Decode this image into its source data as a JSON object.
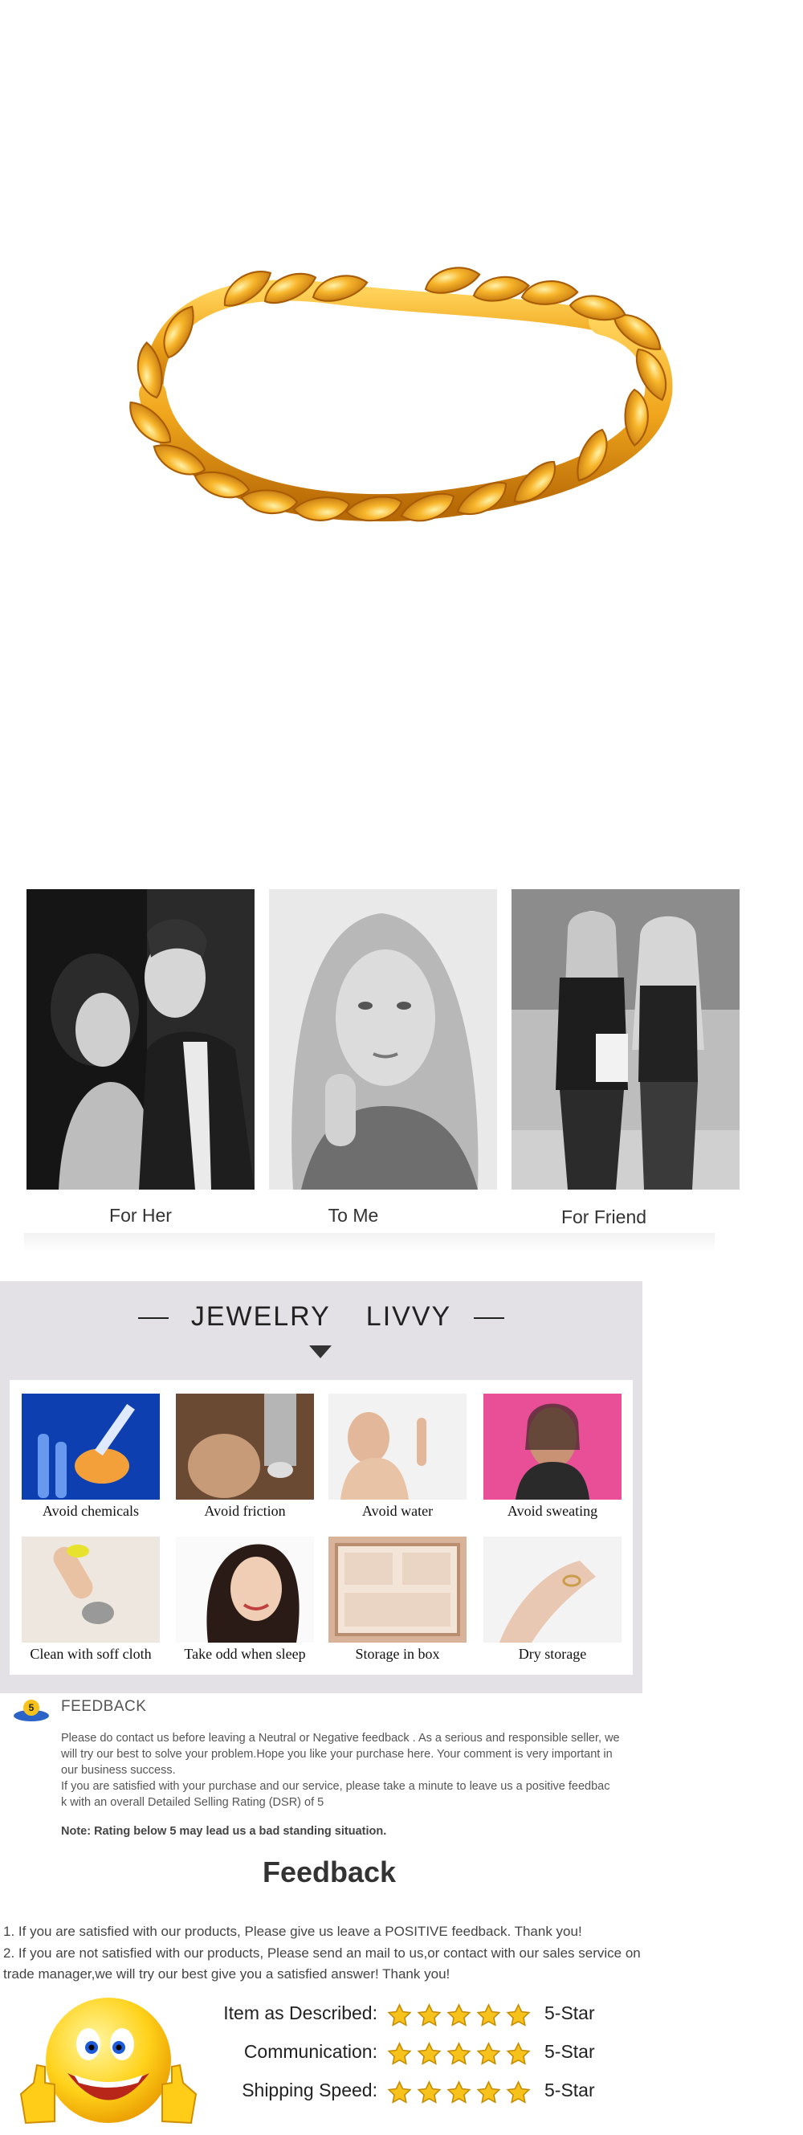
{
  "gifts": [
    {
      "label": "For Her"
    },
    {
      "label": "To Me"
    },
    {
      "label": "For Friend"
    }
  ],
  "care": {
    "title_left": "JEWELRY",
    "title_right": "LIVVY",
    "items": [
      {
        "label": "Avoid chemicals",
        "icon": "chemicals-icon"
      },
      {
        "label": "Avoid friction",
        "icon": "friction-icon"
      },
      {
        "label": "Avoid water",
        "icon": "water-icon"
      },
      {
        "label": "Avoid sweating",
        "icon": "sweating-icon"
      },
      {
        "label": "Clean with soff cloth",
        "icon": "cloth-icon"
      },
      {
        "label": "Take odd when sleep",
        "icon": "sleep-icon"
      },
      {
        "label": "Storage in box",
        "icon": "box-icon"
      },
      {
        "label": "Dry storage",
        "icon": "dry-icon"
      }
    ]
  },
  "feedback": {
    "badge": "5",
    "heading": "FEEDBACK",
    "para1_lines": [
      "Please do contact us before leaving a Neutral or Negative  feedback . As a serious and responsible seller, we",
      "will try our best to solve your problem.Hope you like your purchase here. Your comment is very important in",
      "our business success."
    ],
    "para2_lines": [
      " If you are satisfied with your purchase and our service,  please take a minute to leave us  a positive feedbac",
      "k with an overall  Detailed Selling Rating (DSR) of 5"
    ],
    "note": "Note: Rating below 5 may lead us a bad standing situation.",
    "big_title": "Feedback",
    "line1": "1. If you are satisfied with our products, Please give us leave a POSITIVE feedback. Thank you!",
    "line2a": "2. If you are not satisfied with our products, Please send an mail to us,or contact with our sales service on",
    "line2b": "trade manager,we will try our best give you a satisfied answer! Thank you!"
  },
  "ratings": [
    {
      "label": "Item as Described:",
      "stars": 5,
      "value": "5-Star"
    },
    {
      "label": "Communication:",
      "stars": 5,
      "value": "5-Star"
    },
    {
      "label": "Shipping Speed:",
      "stars": 5,
      "value": "5-Star"
    }
  ],
  "colors": {
    "gold": "#f0a51c",
    "gold_dark": "#c9780a",
    "care_bg": "#e4e1e6",
    "star": "#f7c21b"
  }
}
